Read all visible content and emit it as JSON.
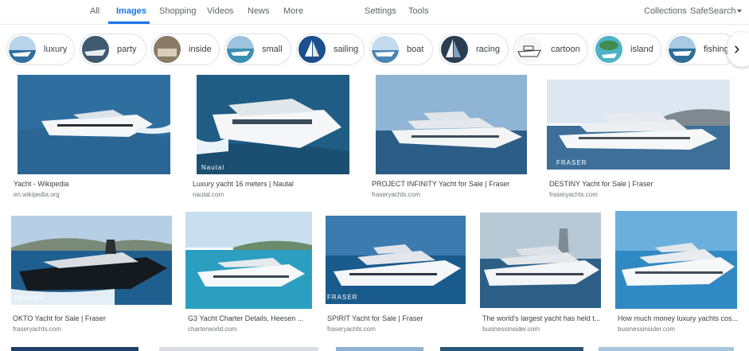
{
  "nav": {
    "tabs": [
      "All",
      "Images",
      "Shopping",
      "Videos",
      "News",
      "More"
    ],
    "settings": "Settings",
    "tools": "Tools",
    "collections": "Collections",
    "safesearch": "SafeSearch"
  },
  "chips": [
    {
      "label": "luxury",
      "thumb": "yacht-photo"
    },
    {
      "label": "party",
      "thumb": "yacht-photo"
    },
    {
      "label": "inside",
      "thumb": "interior-photo"
    },
    {
      "label": "small",
      "thumb": "yacht-photo"
    },
    {
      "label": "sailing",
      "thumb": "sailboat-photo"
    },
    {
      "label": "boat",
      "thumb": "yacht-photo"
    },
    {
      "label": "racing",
      "thumb": "sailboat-photo"
    },
    {
      "label": "cartoon",
      "thumb": "drawing"
    },
    {
      "label": "island",
      "thumb": "island-photo"
    },
    {
      "label": "fishing",
      "thumb": "yacht-photo"
    }
  ],
  "results": [
    {
      "caption": "Yacht - Wikipedia",
      "source": "en.wikipedia.org",
      "watermark": ""
    },
    {
      "caption": "Luxury yacht 16 meters | Nautal",
      "source": "nautal.com",
      "watermark": "Nautal"
    },
    {
      "caption": "PROJECT INFINITY Yacht for Sale | Fraser",
      "source": "fraseryachts.com",
      "watermark": ""
    },
    {
      "caption": "DESTINY Yacht for Sale | Fraser",
      "source": "fraseryachts.com",
      "watermark": "FRASER"
    },
    {
      "caption": "OKTO Yacht for Sale | Fraser",
      "source": "fraseryachts.com",
      "watermark": "FRASER"
    },
    {
      "caption": "G3 Yacht Charter Details, Heesen ...",
      "source": "charterworld.com",
      "watermark": ""
    },
    {
      "caption": "SPIRIT Yacht for Sale | Fraser",
      "source": "fraseryachts.com",
      "watermark": "FRASER"
    },
    {
      "caption": "The world's largest yacht has held t...",
      "source": "businessinsider.com",
      "watermark": ""
    },
    {
      "caption": "How much money luxury yachts cos...",
      "source": "businessinsider.com",
      "watermark": ""
    }
  ],
  "colors": {
    "accent": "#1a73e8",
    "water": "#2f6fa0",
    "sky": "#cfe3f3",
    "hull": "#f4f6f8"
  }
}
